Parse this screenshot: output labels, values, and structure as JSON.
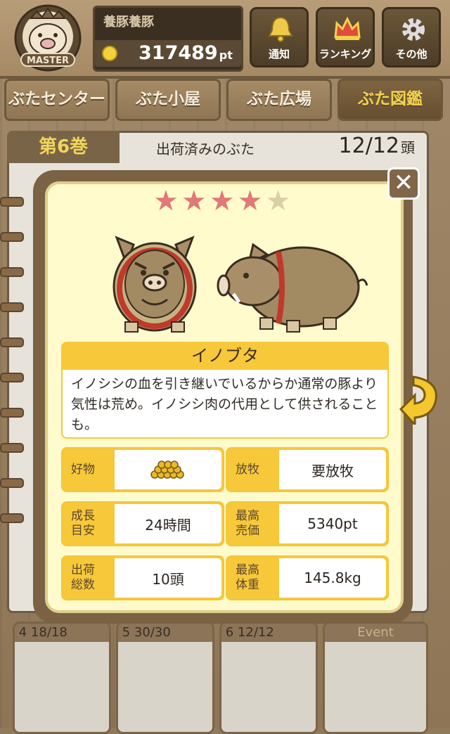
{
  "header": {
    "username": "養豚養豚",
    "points": "317489",
    "points_unit": "pt",
    "badge_label": "MASTER",
    "buttons": [
      {
        "label": "通知",
        "icon": "bell-icon"
      },
      {
        "label": "ランキング",
        "icon": "crown-icon"
      },
      {
        "label": "その他",
        "icon": "gear-icon"
      }
    ]
  },
  "nav": {
    "tabs": [
      {
        "label": "ぶたセンター"
      },
      {
        "label": "ぶた小屋"
      },
      {
        "label": "ぶた広場"
      },
      {
        "label": "ぶた図鑑"
      }
    ],
    "active": "ぶた図鑑"
  },
  "book": {
    "volume": "第6巻",
    "title": "出荷済みのぶた",
    "count": "12/12",
    "count_unit": "頭"
  },
  "modal": {
    "rating": 4,
    "rating_max": 5,
    "name": "イノブタ",
    "description": "イノシシの血を引き継いでいるからか通常の豚より気性は荒め。イノシシ肉の代用として供されることも。",
    "stats": [
      {
        "key": "好物",
        "value": "",
        "icon": "feed-pile-icon"
      },
      {
        "key": "放牧",
        "value": "要放牧"
      },
      {
        "key": "成長目安",
        "value": "24時間"
      },
      {
        "key": "最高売価",
        "value": "5340pt"
      },
      {
        "key": "出荷総数",
        "value": "10頭"
      },
      {
        "key": "最高体重",
        "value": "145.8kg"
      }
    ],
    "close_icon": "close-icon"
  },
  "bottom_cards": [
    {
      "label": "4",
      "count": "18/18"
    },
    {
      "label": "5",
      "count": "30/30"
    },
    {
      "label": "6",
      "count": "12/12"
    },
    {
      "label": "Event",
      "count": ""
    }
  ],
  "colors": {
    "accent": "#f7c83a",
    "modal_bg": "#fffbcd",
    "star_on": "#e27877",
    "wood": "#a2896a"
  }
}
